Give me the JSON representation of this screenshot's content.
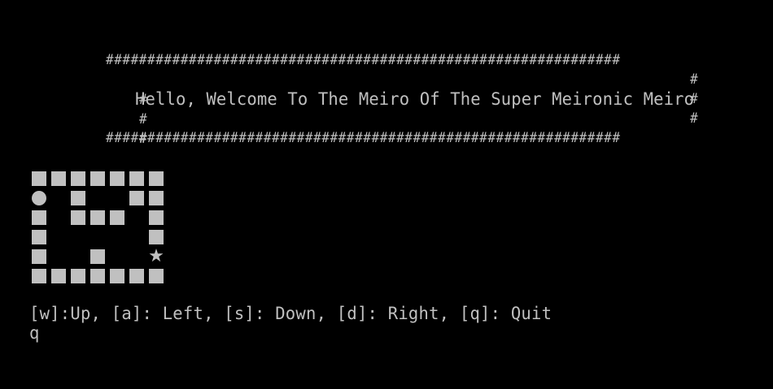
{
  "terminal": {
    "background": "#000000",
    "foreground": "#c0c0c0"
  },
  "banner": {
    "border_line": "##############################################################",
    "side_char": "#",
    "greeting": "Hello, Welcome To The Meiro Of The Super Meironic Meiro"
  },
  "maze": {
    "legend": {
      "#": "wall-block",
      "P": "player-circle",
      "G": "goal-star",
      ".": "empty"
    },
    "grid": [
      "#######",
      "P.#..##",
      "#.###.#",
      "#.....#",
      "#..#..G",
      "#######"
    ],
    "goal_glyph": "★"
  },
  "controls": {
    "text": "[w]:Up, [a]: Left, [s]: Down, [d]: Right, [q]: Quit"
  },
  "input_echo": {
    "text": "q"
  }
}
